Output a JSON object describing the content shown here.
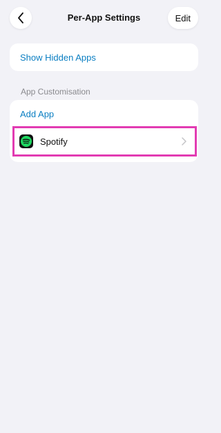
{
  "nav": {
    "title": "Per-App Settings",
    "back_icon": "chevron-left-icon",
    "edit_label": "Edit"
  },
  "hidden_apps": {
    "label": "Show Hidden Apps"
  },
  "app_customisation": {
    "header": "App Customisation",
    "add_app_label": "Add App",
    "apps": [
      {
        "name": "Spotify",
        "icon": "spotify-icon",
        "chevron": "chevron-right-icon"
      }
    ]
  },
  "colors": {
    "accent": "#0a7ec2",
    "background": "#f2f2f7",
    "highlight": "#e23bb2",
    "spotify_green": "#1ed760"
  }
}
